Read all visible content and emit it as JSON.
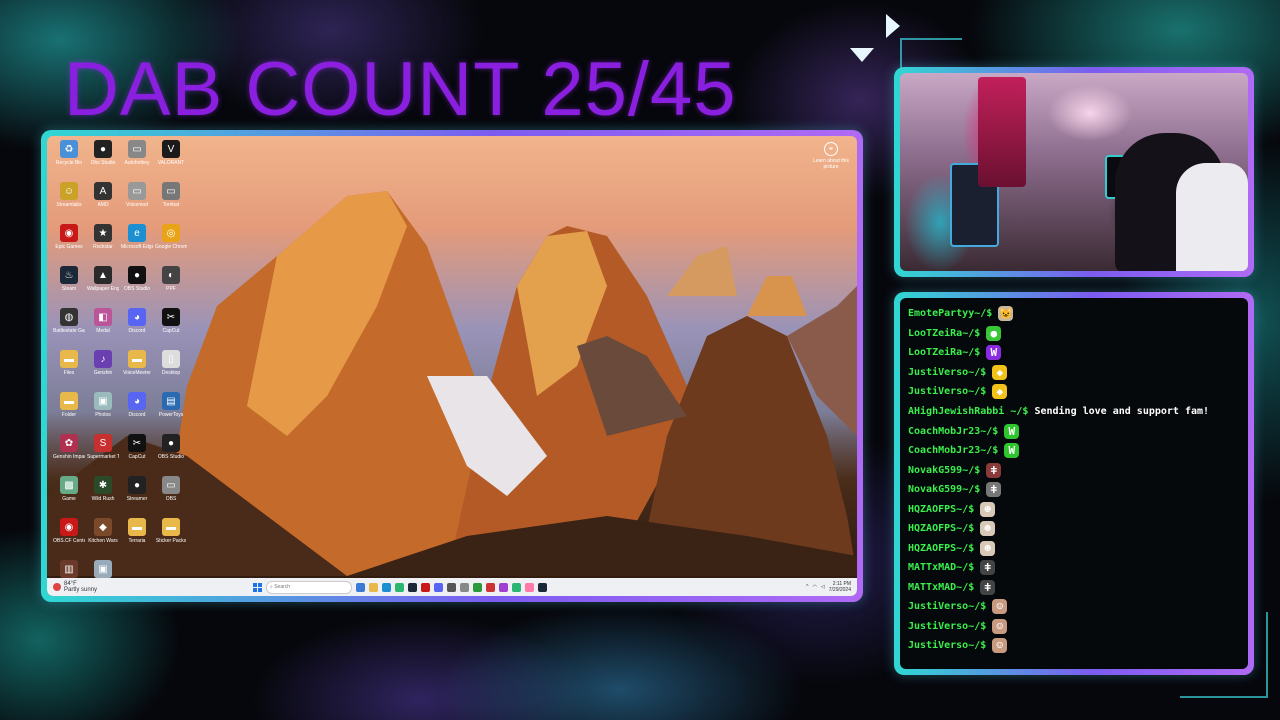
{
  "overlay": {
    "title": "DAB COUNT 25/45"
  },
  "desktop": {
    "icons": [
      {
        "label": "Recycle Bin",
        "icon": "recycle-bin-icon",
        "color": "#4a90d9",
        "glyph": "♻"
      },
      {
        "label": "Obs Studio",
        "icon": "obs-icon",
        "color": "#222",
        "glyph": "●"
      },
      {
        "label": "Autohotkey",
        "icon": "app-icon",
        "color": "#888",
        "glyph": "▭"
      },
      {
        "label": "VALORANT",
        "icon": "valorant-icon",
        "color": "#1a1a1a",
        "glyph": "V"
      },
      {
        "label": "Streamlabs",
        "icon": "streamlabs-icon",
        "color": "#c9a227",
        "glyph": "☺"
      },
      {
        "label": "AMD",
        "icon": "amd-icon",
        "color": "#333",
        "glyph": "A"
      },
      {
        "label": "Voicemod",
        "icon": "app-icon",
        "color": "#999",
        "glyph": "▭"
      },
      {
        "label": "Tombat",
        "icon": "app-icon",
        "color": "#777",
        "glyph": "▭"
      },
      {
        "label": "Epic Games",
        "icon": "epic-icon",
        "color": "#c81818",
        "glyph": "◉"
      },
      {
        "label": "Rockstar",
        "icon": "rockstar-icon",
        "color": "#333",
        "glyph": "★"
      },
      {
        "label": "Microsoft Edge",
        "icon": "edge-icon",
        "color": "#1b8fd1",
        "glyph": "e"
      },
      {
        "label": "Google Chrome",
        "icon": "chrome-icon",
        "color": "#e8a317",
        "glyph": "◎"
      },
      {
        "label": "Steam",
        "icon": "steam-icon",
        "color": "#1b2838",
        "glyph": "♨"
      },
      {
        "label": "Wallpaper Engine",
        "icon": "wallpaper-icon",
        "color": "#2a2a2a",
        "glyph": "▲"
      },
      {
        "label": "OBS Studio",
        "icon": "obs-icon",
        "color": "#111",
        "glyph": "●"
      },
      {
        "label": "PPF",
        "icon": "app-icon",
        "color": "#444",
        "glyph": "◐"
      },
      {
        "label": "Battlestate Games",
        "icon": "app-icon",
        "color": "#333",
        "glyph": "◍"
      },
      {
        "label": "Medal",
        "icon": "app-icon",
        "color": "#b59",
        "glyph": "◧"
      },
      {
        "label": "Discord",
        "icon": "discord-icon",
        "color": "#5865f2",
        "glyph": "◕"
      },
      {
        "label": "CapCut",
        "icon": "capcut-icon",
        "color": "#111",
        "glyph": "✂"
      },
      {
        "label": "Files",
        "icon": "folder-icon",
        "color": "#e8b84a",
        "glyph": "▬"
      },
      {
        "label": "Genshin",
        "icon": "app-icon",
        "color": "#6a3fb0",
        "glyph": "♪"
      },
      {
        "label": "VoiceMeeter",
        "icon": "folder-icon",
        "color": "#e8b84a",
        "glyph": "▬"
      },
      {
        "label": "Desktop",
        "icon": "file-icon",
        "color": "#ddd",
        "glyph": "▯"
      },
      {
        "label": "Folder",
        "icon": "folder-icon",
        "color": "#e8b84a",
        "glyph": "▬"
      },
      {
        "label": "Photos",
        "icon": "photo-icon",
        "color": "#9bb",
        "glyph": "▣"
      },
      {
        "label": "Discord",
        "icon": "discord-icon",
        "color": "#5865f2",
        "glyph": "◕"
      },
      {
        "label": "PowerToys",
        "icon": "app-icon",
        "color": "#2a6ab0",
        "glyph": "▤"
      },
      {
        "label": "Genshin Impact",
        "icon": "app-icon",
        "color": "#b03050",
        "glyph": "✿"
      },
      {
        "label": "Supermarket Together",
        "icon": "app-icon",
        "color": "#c83030",
        "glyph": "S"
      },
      {
        "label": "CapCut",
        "icon": "capcut-icon",
        "color": "#111",
        "glyph": "✂"
      },
      {
        "label": "OBS Studio",
        "icon": "obs-icon",
        "color": "#222",
        "glyph": "●"
      },
      {
        "label": "Game",
        "icon": "app-icon",
        "color": "#6a8",
        "glyph": "▩"
      },
      {
        "label": "Wild Rush",
        "icon": "app-icon",
        "color": "#2a4a2a",
        "glyph": "✱"
      },
      {
        "label": "Streamer",
        "icon": "obs-icon",
        "color": "#222",
        "glyph": "●"
      },
      {
        "label": "OBS",
        "icon": "app-icon",
        "color": "#888",
        "glyph": "▭"
      },
      {
        "label": "OBS.CF Center",
        "icon": "app-icon",
        "color": "#c81818",
        "glyph": "◉"
      },
      {
        "label": "Kitchen Wars",
        "icon": "app-icon",
        "color": "#7a4a2a",
        "glyph": "◆"
      },
      {
        "label": "Terraria",
        "icon": "folder-icon",
        "color": "#e8b84a",
        "glyph": "▬"
      },
      {
        "label": "Sticker Packs",
        "icon": "folder-icon",
        "color": "#e8b84a",
        "glyph": "▬"
      },
      {
        "label": "Backrooms",
        "icon": "app-icon",
        "color": "#6a3a2a",
        "glyph": "▥"
      },
      {
        "label": "Image",
        "icon": "photo-icon",
        "color": "#9ab",
        "glyph": "▣"
      }
    ],
    "learn_label": "Learn about this picture",
    "taskbar": {
      "weather_temp": "84°F",
      "weather_desc": "Partly sunny",
      "search_placeholder": "Search",
      "clock_time": "2:11 PM",
      "clock_date": "7/29/2024",
      "apps": [
        "#3a7bd5",
        "#e8b84a",
        "#1b8fd1",
        "#2bb673",
        "#1b2838",
        "#c81818",
        "#5865f2",
        "#555",
        "#888",
        "#2a9a3a",
        "#c33",
        "#a040d0",
        "#2bb673",
        "#ff7aa8",
        "#1b2838"
      ]
    }
  },
  "chat": {
    "messages": [
      {
        "user": "EmotePartyy",
        "emote": "cat-emote",
        "emote_color": "#c9b7a0",
        "emote_glyph": "😺"
      },
      {
        "user": "LooTZeiRa",
        "emote": "green-emote",
        "emote_color": "#39c739",
        "emote_glyph": "●"
      },
      {
        "user": "LooTZeiRa",
        "emote": "w-emote",
        "emote_color": "#8a2be2",
        "emote_glyph": "W"
      },
      {
        "user": "JustiVerso",
        "emote": "yellow-emote",
        "emote_color": "#f2c21a",
        "emote_glyph": "◆"
      },
      {
        "user": "JustiVerso",
        "emote": "yellow-emote",
        "emote_color": "#f2c21a",
        "emote_glyph": "◆"
      },
      {
        "user": "AHighJewishRabbi",
        "text": "Sending love and support fam!"
      },
      {
        "user": "CoachMobJr23",
        "emote": "w-emote",
        "emote_color": "#2ec52e",
        "emote_glyph": "W"
      },
      {
        "user": "CoachMobJr23",
        "emote": "w-emote",
        "emote_color": "#2ec52e",
        "emote_glyph": "W"
      },
      {
        "user": "NovakG599",
        "emote": "figure-emote",
        "emote_color": "#8a3a3a",
        "emote_glyph": "ǂ"
      },
      {
        "user": "NovakG599",
        "emote": "figure-emote",
        "emote_color": "#777",
        "emote_glyph": "ǂ"
      },
      {
        "user": "HQZAOFPS",
        "emote": "face-emote",
        "emote_color": "#d8c8b8",
        "emote_glyph": "☻"
      },
      {
        "user": "HQZAOFPS",
        "emote": "face-emote",
        "emote_color": "#d8c8b8",
        "emote_glyph": "☻"
      },
      {
        "user": "HQZAOFPS",
        "emote": "face-emote",
        "emote_color": "#d8c8b8",
        "emote_glyph": "☻"
      },
      {
        "user": "MATTxMAD",
        "emote": "figure-emote",
        "emote_color": "#444",
        "emote_glyph": "ǂ"
      },
      {
        "user": "MATTxMAD",
        "emote": "figure-emote",
        "emote_color": "#444",
        "emote_glyph": "ǂ"
      },
      {
        "user": "JustiVerso",
        "emote": "face-emote",
        "emote_color": "#c89a80",
        "emote_glyph": "☺"
      },
      {
        "user": "JustiVerso",
        "emote": "face-emote",
        "emote_color": "#c89a80",
        "emote_glyph": "☺"
      },
      {
        "user": "JustiVerso",
        "emote": "face-emote",
        "emote_color": "#c89a80",
        "emote_glyph": "☺"
      }
    ],
    "prompt": "~/$"
  }
}
